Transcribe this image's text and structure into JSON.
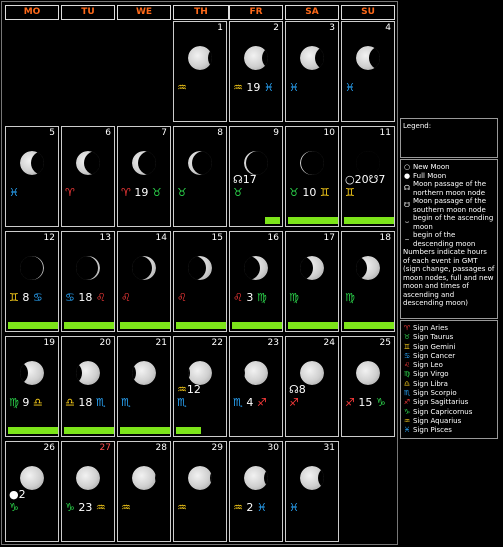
{
  "weekdays": [
    "MO",
    "TU",
    "WE",
    "TH",
    "FR",
    "SA",
    "SU"
  ],
  "days": [
    {
      "n": "1",
      "phase": 0.82,
      "waxing": false,
      "ev": "♒"
    },
    {
      "n": "2",
      "phase": 0.74,
      "waxing": false,
      "ev": "♒ 19 ♓"
    },
    {
      "n": "3",
      "phase": 0.64,
      "waxing": false,
      "ev": "♓"
    },
    {
      "n": "4",
      "phase": 0.55,
      "waxing": false,
      "ev": "♓"
    },
    {
      "n": "5",
      "phase": 0.45,
      "waxing": false,
      "ev": "♓"
    },
    {
      "n": "6",
      "phase": 0.34,
      "waxing": false,
      "ev": "♈"
    },
    {
      "n": "7",
      "phase": 0.24,
      "waxing": false,
      "ev": "♈ 19 ♉"
    },
    {
      "n": "8",
      "phase": 0.15,
      "waxing": false,
      "ev": "♉"
    },
    {
      "n": "9",
      "phase": 0.08,
      "waxing": false,
      "ev": "♉",
      "ev2": "☊17",
      "bar": 0.3
    },
    {
      "n": "10",
      "phase": 0.03,
      "waxing": false,
      "ev": "♉ 10 ♊",
      "bar": 1
    },
    {
      "n": "11",
      "phase": 0.0,
      "waxing": false,
      "ev": "♊",
      "ev2": "○20☋7",
      "bar": 1
    },
    {
      "n": "12",
      "phase": 0.03,
      "waxing": true,
      "ev": "♊ 8 ♋",
      "bar": 1
    },
    {
      "n": "13",
      "phase": 0.08,
      "waxing": true,
      "ev": "♋ 18 ♌",
      "bar": 1
    },
    {
      "n": "14",
      "phase": 0.16,
      "waxing": true,
      "ev": "♌",
      "bar": 1
    },
    {
      "n": "15",
      "phase": 0.25,
      "waxing": true,
      "ev": "♌",
      "bar": 1
    },
    {
      "n": "16",
      "phase": 0.35,
      "waxing": true,
      "ev": "♌ 3 ♍",
      "bar": 1
    },
    {
      "n": "17",
      "phase": 0.45,
      "waxing": true,
      "ev": "♍",
      "bar": 1
    },
    {
      "n": "18",
      "phase": 0.56,
      "waxing": true,
      "ev": "♍",
      "bar": 1
    },
    {
      "n": "19",
      "phase": 0.66,
      "waxing": true,
      "ev": "♍ 9 ♎",
      "bar": 1
    },
    {
      "n": "20",
      "phase": 0.75,
      "waxing": true,
      "ev": "♎ 18 ♏",
      "bar": 1
    },
    {
      "n": "21",
      "phase": 0.83,
      "waxing": true,
      "ev": "♏",
      "bar": 1
    },
    {
      "n": "22",
      "phase": 0.9,
      "waxing": true,
      "ev": "♏",
      "ev2": "♒12",
      "bar": 0.5
    },
    {
      "n": "23",
      "phase": 0.95,
      "waxing": true,
      "ev": "♏ 4 ♐"
    },
    {
      "n": "24",
      "phase": 0.98,
      "waxing": true,
      "ev": "♐",
      "ev2": "☊8"
    },
    {
      "n": "25",
      "phase": 1.0,
      "waxing": true,
      "ev": "♐ 15 ♑"
    },
    {
      "n": "26",
      "phase": 1.0,
      "waxing": false,
      "ev": "♑",
      "ev2": "●2"
    },
    {
      "n": "27",
      "phase": 0.98,
      "waxing": false,
      "ev": "♑ 23 ♒",
      "red": true
    },
    {
      "n": "28",
      "phase": 0.95,
      "waxing": false,
      "ev": "♒"
    },
    {
      "n": "29",
      "phase": 0.9,
      "waxing": false,
      "ev": "♒"
    },
    {
      "n": "30",
      "phase": 0.83,
      "waxing": false,
      "ev": "♒ 2 ♓"
    },
    {
      "n": "31",
      "phase": 0.75,
      "waxing": false,
      "ev": "♓"
    }
  ],
  "legend": {
    "title": "Legend:",
    "items": [
      {
        "sym": "○",
        "text": "New Moon"
      },
      {
        "sym": "●",
        "text": "Full Moon"
      },
      {
        "sym": "☊",
        "text": "Moon passage of the northern moon node"
      },
      {
        "sym": "☋",
        "text": "Moon passage of the southern moon node"
      },
      {
        "sym": "⌣",
        "text": "begin of the ascending moon"
      },
      {
        "sym": "⌢",
        "text": "begin of the descending moon"
      }
    ],
    "note": "Numbers indicate hours of each event in GMT (sign change, passages of moon nodes, full and new moon and times of ascending and descending moon)",
    "signs": [
      {
        "sym": "♈",
        "text": "Sign Aries",
        "color": "#ff3b3b"
      },
      {
        "sym": "♉",
        "text": "Sign Taurus",
        "color": "#2bd24a"
      },
      {
        "sym": "♊",
        "text": "Sign Gemini",
        "color": "#ffd21a"
      },
      {
        "sym": "♋",
        "text": "Sign Cancer",
        "color": "#2aa9ff"
      },
      {
        "sym": "♌",
        "text": "Sign Leo",
        "color": "#ff3b3b"
      },
      {
        "sym": "♍",
        "text": "Sign Virgo",
        "color": "#2bd24a"
      },
      {
        "sym": "♎",
        "text": "Sign Libra",
        "color": "#ffd21a"
      },
      {
        "sym": "♏",
        "text": "Sign Scorpio",
        "color": "#2aa9ff"
      },
      {
        "sym": "♐",
        "text": "Sign Sagittarius",
        "color": "#ff3b3b"
      },
      {
        "sym": "♑",
        "text": "Sign Capricornus",
        "color": "#2bd24a"
      },
      {
        "sym": "♒",
        "text": "Sign Aquarius",
        "color": "#ffd21a"
      },
      {
        "sym": "♓",
        "text": "Sign Pisces",
        "color": "#2aa9ff"
      }
    ]
  },
  "colors": {
    "bar": "#7de51a",
    "header": "#ff6a1a"
  }
}
